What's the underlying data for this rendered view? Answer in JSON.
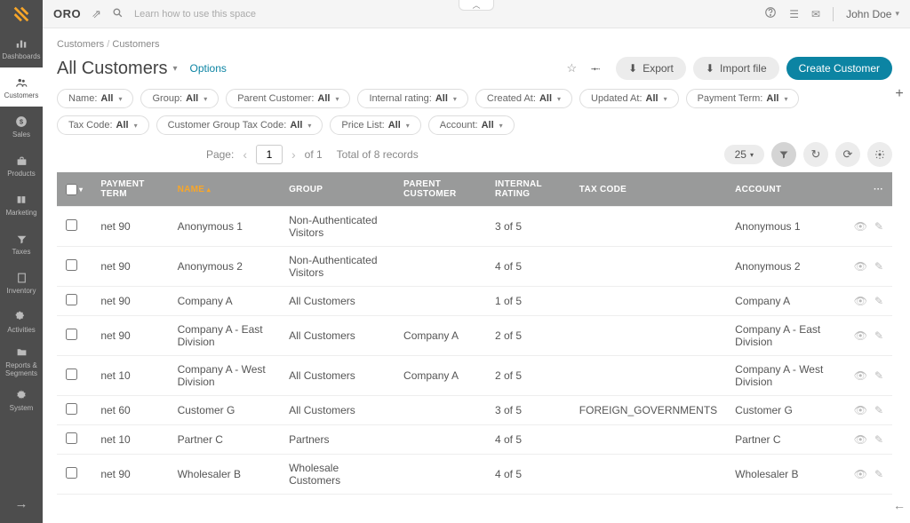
{
  "brand": "ORO",
  "topbar": {
    "learn": "Learn how to use this space",
    "user": "John Doe"
  },
  "sidebar": [
    {
      "label": "Dashboards",
      "icon": "bars"
    },
    {
      "label": "Customers",
      "icon": "users",
      "active": true
    },
    {
      "label": "Sales",
      "icon": "dollar"
    },
    {
      "label": "Products",
      "icon": "briefcase"
    },
    {
      "label": "Marketing",
      "icon": "book"
    },
    {
      "label": "Taxes",
      "icon": "filter"
    },
    {
      "label": "Inventory",
      "icon": "building"
    },
    {
      "label": "Activities",
      "icon": "puzzle"
    },
    {
      "label": "Reports & Segments",
      "icon": "folder"
    },
    {
      "label": "System",
      "icon": "gear"
    }
  ],
  "breadcrumb": {
    "a": "Customers",
    "b": "Customers"
  },
  "page": {
    "title": "All Customers",
    "options": "Options",
    "export": "Export",
    "import": "Import file",
    "create": "Create Customer"
  },
  "filters": [
    {
      "label": "Name:",
      "value": "All"
    },
    {
      "label": "Group:",
      "value": "All"
    },
    {
      "label": "Parent Customer:",
      "value": "All"
    },
    {
      "label": "Internal rating:",
      "value": "All"
    },
    {
      "label": "Created At:",
      "value": "All"
    },
    {
      "label": "Updated At:",
      "value": "All"
    },
    {
      "label": "Payment Term:",
      "value": "All"
    },
    {
      "label": "Tax Code:",
      "value": "All"
    },
    {
      "label": "Customer Group Tax Code:",
      "value": "All"
    },
    {
      "label": "Price List:",
      "value": "All"
    },
    {
      "label": "Account:",
      "value": "All"
    }
  ],
  "pager": {
    "label": "Page:",
    "page": "1",
    "of": "of 1",
    "total": "Total of 8 records",
    "perpage": "25"
  },
  "columns": [
    "PAYMENT TERM",
    "NAME",
    "GROUP",
    "PARENT CUSTOMER",
    "INTERNAL RATING",
    "TAX CODE",
    "ACCOUNT",
    "···"
  ],
  "rows": [
    {
      "payment": "net 90",
      "name": "Anonymous 1",
      "group": "Non-Authenticated Visitors",
      "parent": "",
      "rating": "3 of 5",
      "tax": "",
      "account": "Anonymous 1"
    },
    {
      "payment": "net 90",
      "name": "Anonymous 2",
      "group": "Non-Authenticated Visitors",
      "parent": "",
      "rating": "4 of 5",
      "tax": "",
      "account": "Anonymous 2"
    },
    {
      "payment": "net 90",
      "name": "Company A",
      "group": "All Customers",
      "parent": "",
      "rating": "1 of 5",
      "tax": "",
      "account": "Company A"
    },
    {
      "payment": "net 90",
      "name": "Company A - East Division",
      "group": "All Customers",
      "parent": "Company A",
      "rating": "2 of 5",
      "tax": "",
      "account": "Company A - East Division"
    },
    {
      "payment": "net 10",
      "name": "Company A - West Division",
      "group": "All Customers",
      "parent": "Company A",
      "rating": "2 of 5",
      "tax": "",
      "account": "Company A - West Division"
    },
    {
      "payment": "net 60",
      "name": "Customer G",
      "group": "All Customers",
      "parent": "",
      "rating": "3 of 5",
      "tax": "FOREIGN_GOVERNMENTS",
      "account": "Customer G"
    },
    {
      "payment": "net 10",
      "name": "Partner C",
      "group": "Partners",
      "parent": "",
      "rating": "4 of 5",
      "tax": "",
      "account": "Partner C"
    },
    {
      "payment": "net 90",
      "name": "Wholesaler B",
      "group": "Wholesale Customers",
      "parent": "",
      "rating": "4 of 5",
      "tax": "",
      "account": "Wholesaler B"
    }
  ]
}
